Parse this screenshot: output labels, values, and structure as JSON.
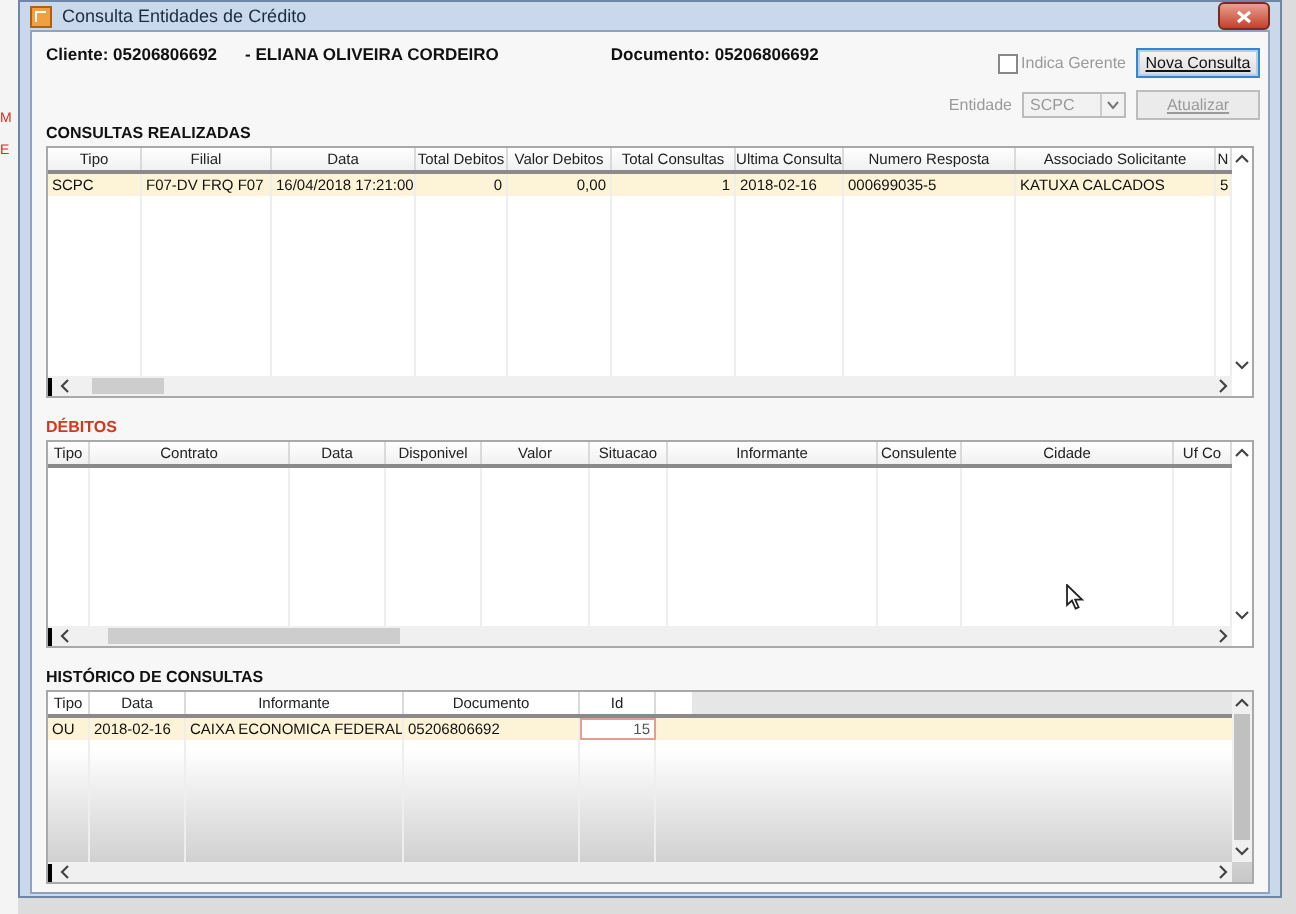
{
  "left_edge": [
    "M",
    "E"
  ],
  "window": {
    "title": "Consulta Entidades de Crédito"
  },
  "header": {
    "client": "Cliente: 05206806692",
    "name": "- ELIANA OLIVEIRA CORDEIRO",
    "document": "Documento: 05206806692"
  },
  "indica_gerente": {
    "label": "Indica Gerente",
    "checked": false,
    "disabled": true
  },
  "entidade": {
    "label": "Entidade",
    "value": "SCPC",
    "disabled": true
  },
  "buttons": [
    {
      "label": "Nova Consulta",
      "disabled": false,
      "focused": true
    },
    {
      "label": "Atualizar",
      "disabled": true,
      "focused": false
    }
  ],
  "sections": [
    {
      "title": "CONSULTAS REALIZADAS",
      "alert": false,
      "columns": [
        {
          "label": "Tipo",
          "kind": "text"
        },
        {
          "label": "Filial",
          "kind": "text"
        },
        {
          "label": "Data",
          "kind": "text"
        },
        {
          "label": "Total Debitos",
          "kind": "number"
        },
        {
          "label": "Valor Debitos",
          "kind": "number"
        },
        {
          "label": "Total Consultas",
          "kind": "number"
        },
        {
          "label": "Ultima Consulta",
          "kind": "text"
        },
        {
          "label": "Numero Resposta",
          "kind": "text"
        },
        {
          "label": "Associado Solicitante",
          "kind": "text"
        },
        {
          "label": "N",
          "kind": "text"
        }
      ],
      "rows": [
        {
          "selected": true,
          "cells": [
            {
              "text": "SCPC",
              "focused": false
            },
            {
              "text": "F07-DV FRQ F07",
              "focused": false
            },
            {
              "text": "16/04/2018 17:21:00",
              "focused": false
            },
            {
              "text": "0",
              "focused": false
            },
            {
              "text": "0,00",
              "focused": false
            },
            {
              "text": "1",
              "focused": false
            },
            {
              "text": "2018-02-16",
              "focused": false
            },
            {
              "text": "000699035-5",
              "focused": false
            },
            {
              "text": "KATUXA CALCADOS",
              "focused": false
            },
            {
              "text": "5",
              "focused": false
            }
          ]
        }
      ]
    },
    {
      "title": "DÉBITOS",
      "alert": true,
      "columns": [
        {
          "label": "Tipo"
        },
        {
          "label": "Contrato"
        },
        {
          "label": "Data"
        },
        {
          "label": "Disponivel"
        },
        {
          "label": "Valor"
        },
        {
          "label": "Situacao"
        },
        {
          "label": "Informante"
        },
        {
          "label": "Consulente"
        },
        {
          "label": "Cidade"
        },
        {
          "label": "Uf Co"
        }
      ]
    },
    {
      "title": "HISTÓRICO DE CONSULTAS",
      "alert": false,
      "columns": [
        {
          "label": "Tipo",
          "kind": "text"
        },
        {
          "label": "Data",
          "kind": "text"
        },
        {
          "label": "Informante",
          "kind": "text"
        },
        {
          "label": "Documento",
          "kind": "text"
        },
        {
          "label": "Id",
          "kind": "number"
        }
      ],
      "rows": [
        {
          "selected": true,
          "cells": [
            {
              "text": "OU",
              "focused": false
            },
            {
              "text": "2018-02-16",
              "focused": false
            },
            {
              "text": "CAIXA ECONOMICA FEDERAL",
              "focused": false
            },
            {
              "text": "05206806692",
              "focused": false
            },
            {
              "text": "15",
              "focused": true
            }
          ]
        }
      ]
    }
  ]
}
